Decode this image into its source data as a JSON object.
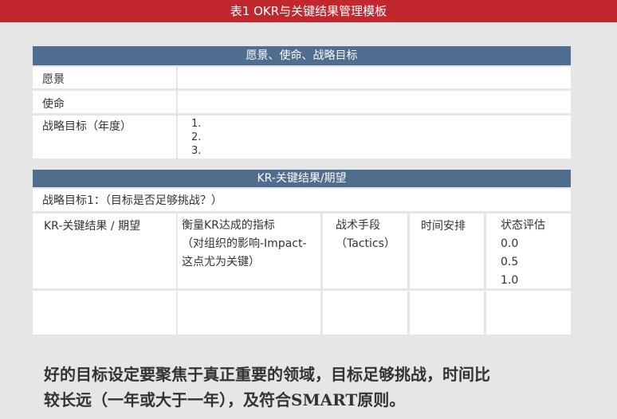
{
  "title": "表1  OKR与关键结果管理模板",
  "vision_section": {
    "header": "愿景、使命、战略目标",
    "vision_label": "愿景",
    "mission_label": "使命",
    "strategic_label": "战略目标（年度）",
    "items": [
      "1.",
      "2.",
      "3."
    ]
  },
  "kr_section": {
    "header": "KR-关键结果/期望",
    "objective_label": "战略目标1：（目标是否足够挑战？）",
    "columns": {
      "kr": "KR-关键结果 / 期望",
      "metric_lines": [
        "衡量KR达成的指标",
        "（对组织的影响-Impact-",
        "这点尤为关键）"
      ],
      "tactics_lines": [
        "战术手段",
        "（Tactics）"
      ],
      "schedule": "时间安排",
      "status_lines": [
        "状态评估",
        "0.0",
        "0.5",
        "1.0"
      ]
    }
  },
  "caption_lines": [
    "好的目标设定要聚焦于真正重要的领域，目标足够挑战，时间比",
    "较长远（一年或大于一年），及符合SMART原则。"
  ]
}
